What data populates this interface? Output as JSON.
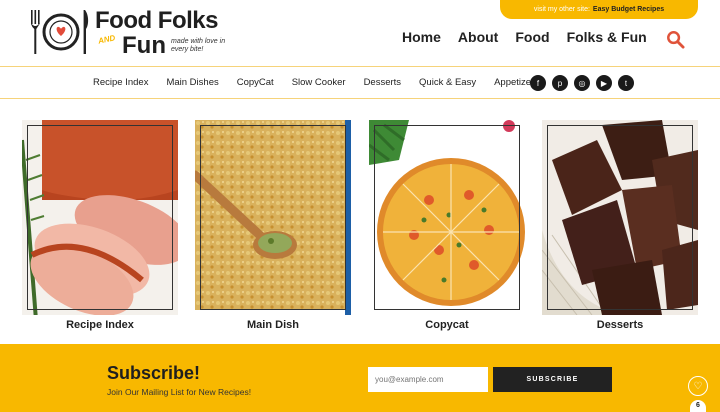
{
  "promo": {
    "prefix": "visit my other site:",
    "link": "Easy Budget Recipes"
  },
  "logo": {
    "line1": "Food Folks",
    "and": "AND",
    "line2": "Fun",
    "tagline": "made with love in every bite!"
  },
  "nav": {
    "items": [
      "Home",
      "About",
      "Food",
      "Folks & Fun"
    ]
  },
  "categories": [
    "Recipe Index",
    "Main Dishes",
    "CopyCat",
    "Slow Cooker",
    "Desserts",
    "Quick & Easy",
    "Appetizers"
  ],
  "social": [
    {
      "icon": "facebook-icon",
      "glyph": "f"
    },
    {
      "icon": "pinterest-icon",
      "glyph": "p"
    },
    {
      "icon": "instagram-icon",
      "glyph": "◎"
    },
    {
      "icon": "youtube-icon",
      "glyph": "▶"
    },
    {
      "icon": "twitter-icon",
      "glyph": "t"
    }
  ],
  "cards": [
    {
      "label": "Recipe Index"
    },
    {
      "label": "Main Dish"
    },
    {
      "label": "Copycat"
    },
    {
      "label": "Desserts"
    }
  ],
  "subscribe": {
    "title": "Subscribe!",
    "subtitle": "Join Our Mailing List for New Recipes!",
    "email_placeholder": "you@example.com",
    "button": "SUBSCRIBE"
  },
  "favorites": {
    "count": "6"
  },
  "colors": {
    "accent": "#f8b800",
    "dark": "#222222"
  }
}
